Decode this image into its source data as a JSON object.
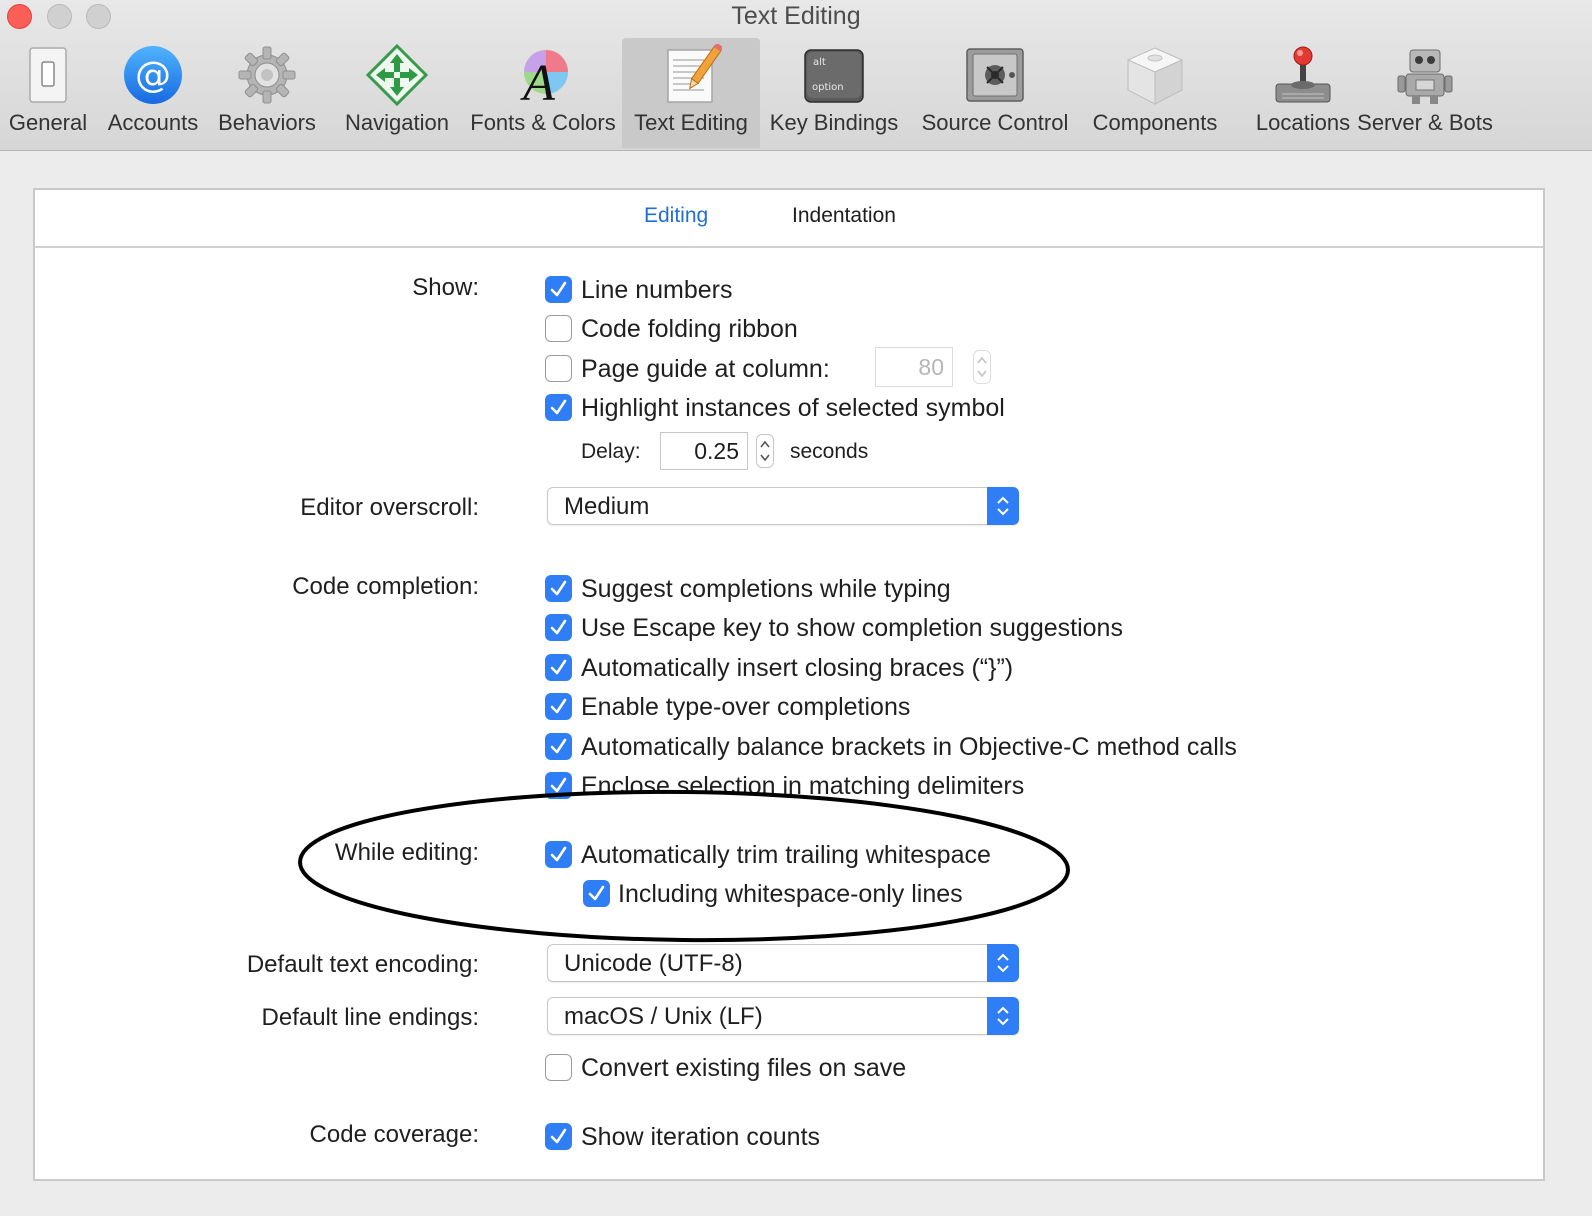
{
  "window": {
    "title": "Text Editing"
  },
  "toolbar": {
    "items": [
      {
        "label": "General",
        "icon": "switch-icon"
      },
      {
        "label": "Accounts",
        "icon": "at-sign-icon"
      },
      {
        "label": "Behaviors",
        "icon": "gear-icon"
      },
      {
        "label": "Navigation",
        "icon": "move-arrows-icon"
      },
      {
        "label": "Fonts & Colors",
        "icon": "font-color-wheel-icon"
      },
      {
        "label": "Text Editing",
        "icon": "notepad-pencil-icon",
        "selected": true
      },
      {
        "label": "Key Bindings",
        "icon": "alt-option-key-icon",
        "key_top": "alt",
        "key_bottom": "option"
      },
      {
        "label": "Source Control",
        "icon": "safe-icon"
      },
      {
        "label": "Components",
        "icon": "box-icon"
      },
      {
        "label": "Locations",
        "icon": "joystick-icon"
      },
      {
        "label": "Server & Bots",
        "icon": "robot-icon"
      }
    ]
  },
  "tabs": [
    {
      "label": "Editing",
      "active": true
    },
    {
      "label": "Indentation",
      "active": false
    }
  ],
  "show": {
    "label": "Show:",
    "line_numbers": {
      "label": "Line numbers",
      "checked": true
    },
    "code_folding": {
      "label": "Code folding ribbon",
      "checked": false
    },
    "page_guide": {
      "label": "Page guide at column:",
      "checked": false,
      "value": "80"
    },
    "highlight": {
      "label": "Highlight instances of selected symbol",
      "checked": true
    },
    "delay_label": "Delay:",
    "delay_value": "0.25",
    "delay_unit": "seconds"
  },
  "overscroll": {
    "label": "Editor overscroll:",
    "value": "Medium"
  },
  "completion": {
    "label": "Code completion:",
    "items": [
      {
        "label": "Suggest completions while typing",
        "checked": true
      },
      {
        "label": "Use Escape key to show completion suggestions",
        "checked": true
      },
      {
        "label": "Automatically insert closing braces (“}”)",
        "checked": true
      },
      {
        "label": "Enable type-over completions",
        "checked": true
      },
      {
        "label": "Automatically balance brackets in Objective-C method calls",
        "checked": true
      },
      {
        "label": "Enclose selection in matching delimiters",
        "checked": true
      }
    ]
  },
  "while_editing": {
    "label": "While editing:",
    "trim": {
      "label": "Automatically trim trailing whitespace",
      "checked": true
    },
    "whitespace_only": {
      "label": "Including whitespace-only lines",
      "checked": true
    }
  },
  "encoding": {
    "label": "Default text encoding:",
    "value": "Unicode (UTF-8)"
  },
  "line_endings": {
    "label": "Default line endings:",
    "value": "macOS / Unix (LF)",
    "convert": {
      "label": "Convert existing files on save",
      "checked": false
    }
  },
  "coverage": {
    "label": "Code coverage:",
    "iteration": {
      "label": "Show iteration counts",
      "checked": true
    }
  },
  "colors": {
    "accent": "#2f7ef5",
    "active_tab": "#1f6fd6",
    "close_button": "#fd5f57"
  }
}
